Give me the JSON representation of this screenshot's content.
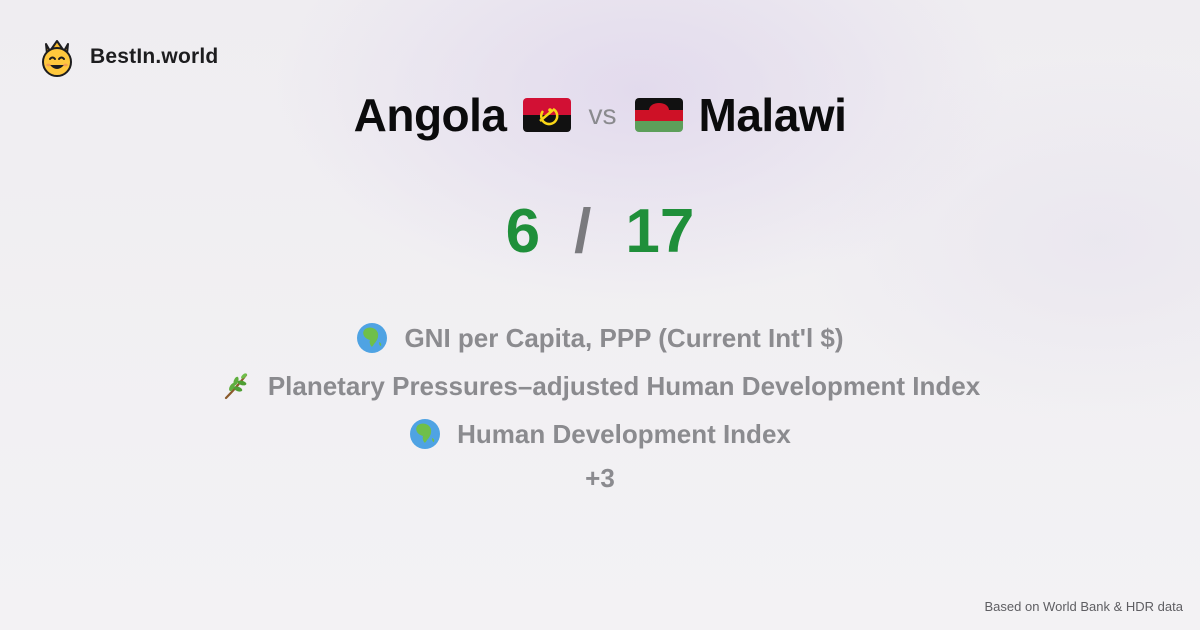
{
  "brand": {
    "name": "BestIn.world",
    "icon": "crowned-smiley-icon"
  },
  "title": {
    "left_country": "Angola",
    "left_flag": "angola-flag-icon",
    "vs_label": "vs",
    "right_country": "Malawi",
    "right_flag": "malawi-flag-icon"
  },
  "score": {
    "left": "6",
    "separator": "/",
    "right": "17",
    "color": "#1f8f3a"
  },
  "metrics": [
    {
      "icon": "globe-africa-icon",
      "label": "GNI per Capita, PPP (Current Int'l $)"
    },
    {
      "icon": "herb-icon",
      "label": "Planetary Pressures–adjusted Human Development Index"
    },
    {
      "icon": "globe-africa-icon",
      "label": "Human Development Index"
    }
  ],
  "more_label": "+3",
  "footer": {
    "source": "Based on World Bank & HDR data"
  }
}
